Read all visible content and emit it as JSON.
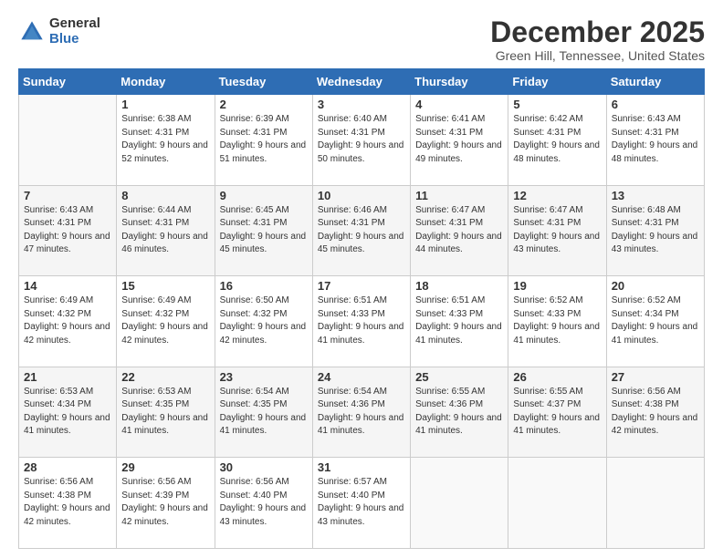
{
  "logo": {
    "general": "General",
    "blue": "Blue"
  },
  "title": "December 2025",
  "subtitle": "Green Hill, Tennessee, United States",
  "days_of_week": [
    "Sunday",
    "Monday",
    "Tuesday",
    "Wednesday",
    "Thursday",
    "Friday",
    "Saturday"
  ],
  "weeks": [
    [
      {
        "day": "",
        "sunrise": "",
        "sunset": "",
        "daylight": ""
      },
      {
        "day": "1",
        "sunrise": "Sunrise: 6:38 AM",
        "sunset": "Sunset: 4:31 PM",
        "daylight": "Daylight: 9 hours and 52 minutes."
      },
      {
        "day": "2",
        "sunrise": "Sunrise: 6:39 AM",
        "sunset": "Sunset: 4:31 PM",
        "daylight": "Daylight: 9 hours and 51 minutes."
      },
      {
        "day": "3",
        "sunrise": "Sunrise: 6:40 AM",
        "sunset": "Sunset: 4:31 PM",
        "daylight": "Daylight: 9 hours and 50 minutes."
      },
      {
        "day": "4",
        "sunrise": "Sunrise: 6:41 AM",
        "sunset": "Sunset: 4:31 PM",
        "daylight": "Daylight: 9 hours and 49 minutes."
      },
      {
        "day": "5",
        "sunrise": "Sunrise: 6:42 AM",
        "sunset": "Sunset: 4:31 PM",
        "daylight": "Daylight: 9 hours and 48 minutes."
      },
      {
        "day": "6",
        "sunrise": "Sunrise: 6:43 AM",
        "sunset": "Sunset: 4:31 PM",
        "daylight": "Daylight: 9 hours and 48 minutes."
      }
    ],
    [
      {
        "day": "7",
        "sunrise": "Sunrise: 6:43 AM",
        "sunset": "Sunset: 4:31 PM",
        "daylight": "Daylight: 9 hours and 47 minutes."
      },
      {
        "day": "8",
        "sunrise": "Sunrise: 6:44 AM",
        "sunset": "Sunset: 4:31 PM",
        "daylight": "Daylight: 9 hours and 46 minutes."
      },
      {
        "day": "9",
        "sunrise": "Sunrise: 6:45 AM",
        "sunset": "Sunset: 4:31 PM",
        "daylight": "Daylight: 9 hours and 45 minutes."
      },
      {
        "day": "10",
        "sunrise": "Sunrise: 6:46 AM",
        "sunset": "Sunset: 4:31 PM",
        "daylight": "Daylight: 9 hours and 45 minutes."
      },
      {
        "day": "11",
        "sunrise": "Sunrise: 6:47 AM",
        "sunset": "Sunset: 4:31 PM",
        "daylight": "Daylight: 9 hours and 44 minutes."
      },
      {
        "day": "12",
        "sunrise": "Sunrise: 6:47 AM",
        "sunset": "Sunset: 4:31 PM",
        "daylight": "Daylight: 9 hours and 43 minutes."
      },
      {
        "day": "13",
        "sunrise": "Sunrise: 6:48 AM",
        "sunset": "Sunset: 4:31 PM",
        "daylight": "Daylight: 9 hours and 43 minutes."
      }
    ],
    [
      {
        "day": "14",
        "sunrise": "Sunrise: 6:49 AM",
        "sunset": "Sunset: 4:32 PM",
        "daylight": "Daylight: 9 hours and 42 minutes."
      },
      {
        "day": "15",
        "sunrise": "Sunrise: 6:49 AM",
        "sunset": "Sunset: 4:32 PM",
        "daylight": "Daylight: 9 hours and 42 minutes."
      },
      {
        "day": "16",
        "sunrise": "Sunrise: 6:50 AM",
        "sunset": "Sunset: 4:32 PM",
        "daylight": "Daylight: 9 hours and 42 minutes."
      },
      {
        "day": "17",
        "sunrise": "Sunrise: 6:51 AM",
        "sunset": "Sunset: 4:33 PM",
        "daylight": "Daylight: 9 hours and 41 minutes."
      },
      {
        "day": "18",
        "sunrise": "Sunrise: 6:51 AM",
        "sunset": "Sunset: 4:33 PM",
        "daylight": "Daylight: 9 hours and 41 minutes."
      },
      {
        "day": "19",
        "sunrise": "Sunrise: 6:52 AM",
        "sunset": "Sunset: 4:33 PM",
        "daylight": "Daylight: 9 hours and 41 minutes."
      },
      {
        "day": "20",
        "sunrise": "Sunrise: 6:52 AM",
        "sunset": "Sunset: 4:34 PM",
        "daylight": "Daylight: 9 hours and 41 minutes."
      }
    ],
    [
      {
        "day": "21",
        "sunrise": "Sunrise: 6:53 AM",
        "sunset": "Sunset: 4:34 PM",
        "daylight": "Daylight: 9 hours and 41 minutes."
      },
      {
        "day": "22",
        "sunrise": "Sunrise: 6:53 AM",
        "sunset": "Sunset: 4:35 PM",
        "daylight": "Daylight: 9 hours and 41 minutes."
      },
      {
        "day": "23",
        "sunrise": "Sunrise: 6:54 AM",
        "sunset": "Sunset: 4:35 PM",
        "daylight": "Daylight: 9 hours and 41 minutes."
      },
      {
        "day": "24",
        "sunrise": "Sunrise: 6:54 AM",
        "sunset": "Sunset: 4:36 PM",
        "daylight": "Daylight: 9 hours and 41 minutes."
      },
      {
        "day": "25",
        "sunrise": "Sunrise: 6:55 AM",
        "sunset": "Sunset: 4:36 PM",
        "daylight": "Daylight: 9 hours and 41 minutes."
      },
      {
        "day": "26",
        "sunrise": "Sunrise: 6:55 AM",
        "sunset": "Sunset: 4:37 PM",
        "daylight": "Daylight: 9 hours and 41 minutes."
      },
      {
        "day": "27",
        "sunrise": "Sunrise: 6:56 AM",
        "sunset": "Sunset: 4:38 PM",
        "daylight": "Daylight: 9 hours and 42 minutes."
      }
    ],
    [
      {
        "day": "28",
        "sunrise": "Sunrise: 6:56 AM",
        "sunset": "Sunset: 4:38 PM",
        "daylight": "Daylight: 9 hours and 42 minutes."
      },
      {
        "day": "29",
        "sunrise": "Sunrise: 6:56 AM",
        "sunset": "Sunset: 4:39 PM",
        "daylight": "Daylight: 9 hours and 42 minutes."
      },
      {
        "day": "30",
        "sunrise": "Sunrise: 6:56 AM",
        "sunset": "Sunset: 4:40 PM",
        "daylight": "Daylight: 9 hours and 43 minutes."
      },
      {
        "day": "31",
        "sunrise": "Sunrise: 6:57 AM",
        "sunset": "Sunset: 4:40 PM",
        "daylight": "Daylight: 9 hours and 43 minutes."
      },
      {
        "day": "",
        "sunrise": "",
        "sunset": "",
        "daylight": ""
      },
      {
        "day": "",
        "sunrise": "",
        "sunset": "",
        "daylight": ""
      },
      {
        "day": "",
        "sunrise": "",
        "sunset": "",
        "daylight": ""
      }
    ]
  ]
}
